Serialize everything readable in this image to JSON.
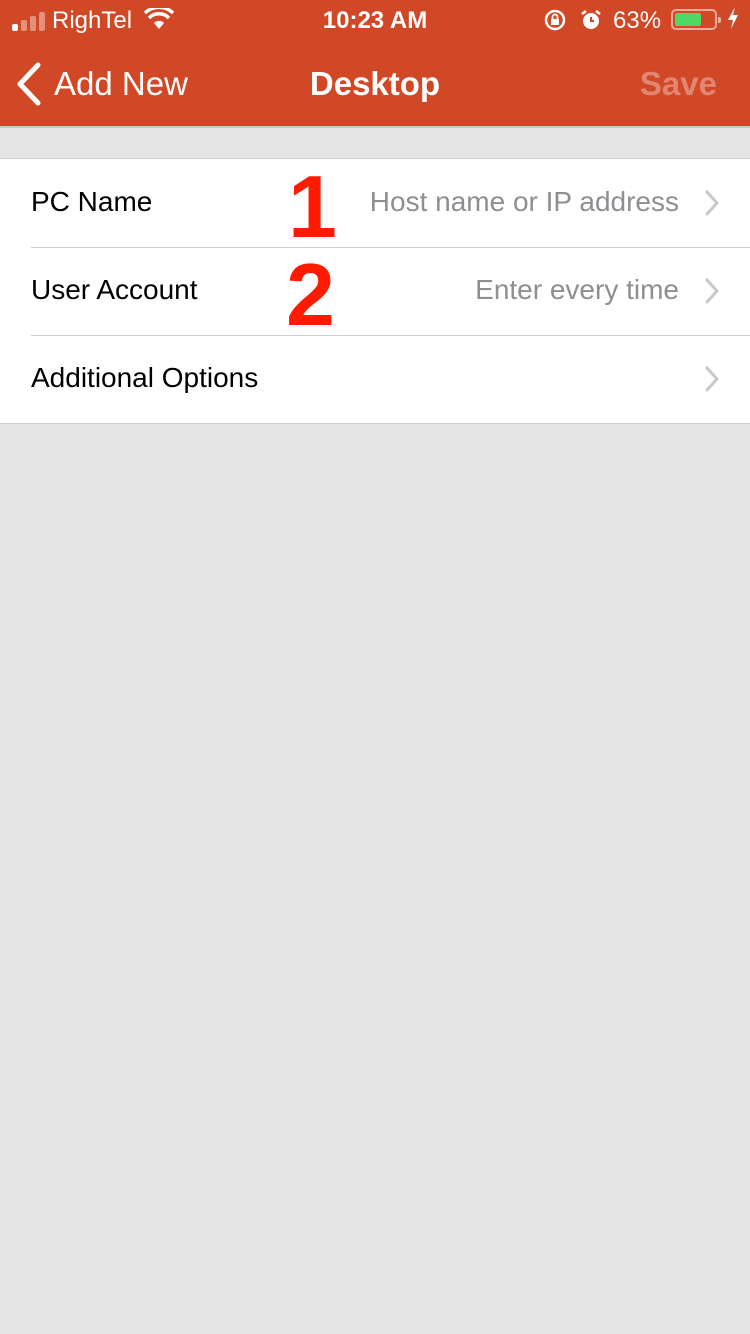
{
  "status_bar": {
    "carrier": "RighTel",
    "time": "10:23 AM",
    "battery_percent_label": "63%",
    "battery_level": 0.63,
    "signal_bars_active": 1,
    "signal_bars_total": 4,
    "icons": [
      "signal-icon",
      "wifi-icon",
      "rotation-lock-icon",
      "alarm-icon",
      "battery-icon",
      "charging-bolt-icon"
    ]
  },
  "nav": {
    "back_label": "Add New",
    "title": "Desktop",
    "save_label": "Save"
  },
  "colors": {
    "header": "#d14826",
    "background": "#e5e5e5",
    "annotation": "#ff1a00",
    "placeholder": "#8e8e93"
  },
  "rows": [
    {
      "label": "PC Name",
      "value": "Host name or IP address"
    },
    {
      "label": "User Account",
      "value": "Enter every time"
    },
    {
      "label": "Additional Options",
      "value": ""
    }
  ],
  "annotations": [
    "1",
    "2"
  ]
}
